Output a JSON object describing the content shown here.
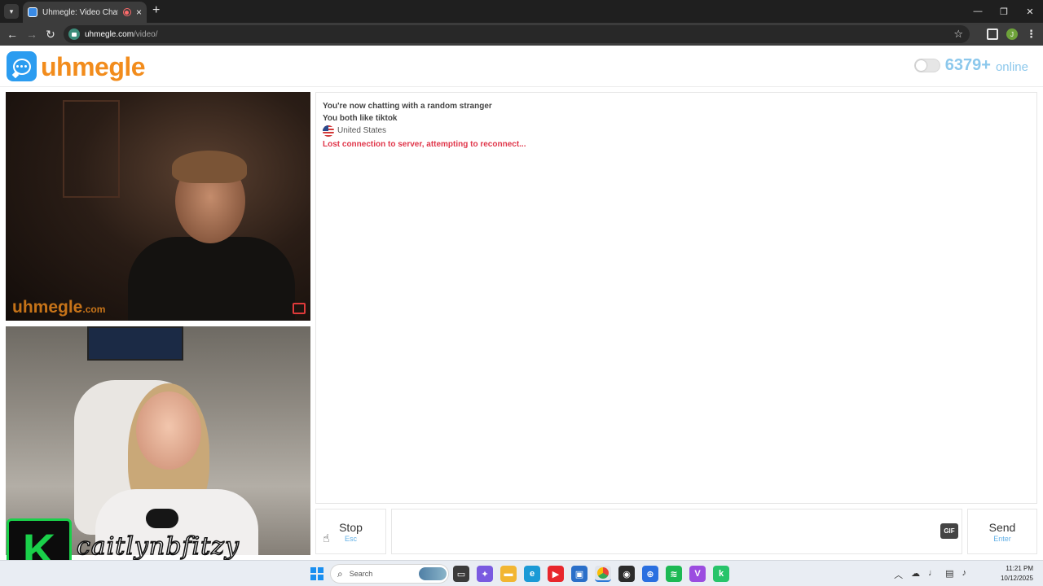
{
  "browser": {
    "tab_title": "Uhmegle: Video Chat | Ome",
    "new_tab_glyph": "+",
    "url_domain": "uhmegle.com",
    "url_path": "/video/",
    "profile_initial": "J"
  },
  "site": {
    "logo_text": "uhmegle",
    "online_count": "6379+",
    "online_label": "online"
  },
  "video": {
    "watermark_main": "uhmegle",
    "watermark_tld": ".com",
    "streamer_badge_letter": "K",
    "streamer_handle": "caitlynbfitzy"
  },
  "chat": {
    "messages": [
      "You're now chatting with a random stranger",
      "You both like tiktok"
    ],
    "country": "United States",
    "error": "Lost connection to server, attempting to reconnect..."
  },
  "controls": {
    "stop_label": "Stop",
    "stop_hint": "Esc",
    "gif_label": "GIF",
    "send_label": "Send",
    "send_hint": "Enter"
  },
  "taskbar": {
    "search_placeholder": "Search",
    "time": "11:21 PM",
    "date": "10/12/2025"
  },
  "colors": {
    "brand_orange": "#f28c1c",
    "brand_blue": "#2b9cf0",
    "online_blue": "#8cc8ec",
    "error_red": "#e0364a",
    "hint_blue": "#62b0e6"
  }
}
